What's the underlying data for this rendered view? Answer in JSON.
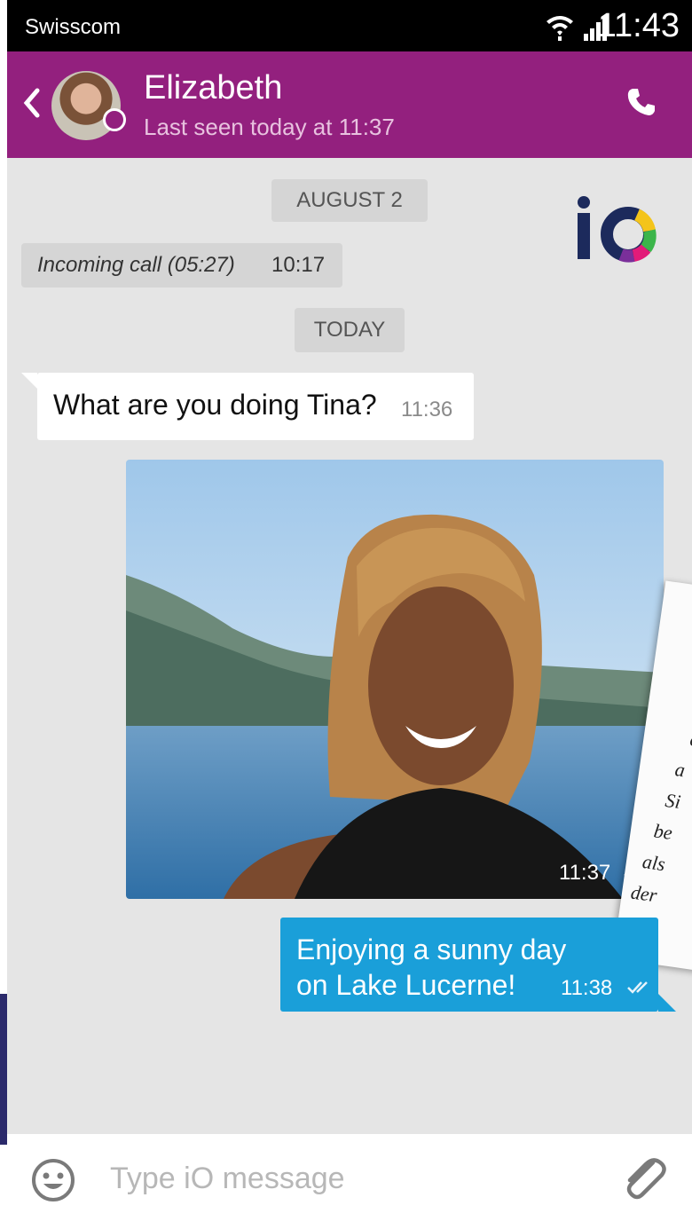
{
  "status_bar": {
    "carrier": "Swisscom",
    "time": "11:43"
  },
  "header": {
    "back_icon": "chevron-left-icon",
    "contact_name": "Elizabeth",
    "last_seen": "Last seen today at 11:37",
    "call_icon": "phone-icon",
    "color": "#93207e"
  },
  "chat": {
    "date_chips": [
      "AUGUST 2",
      "TODAY"
    ],
    "call_log": {
      "label": "Incoming call (05:27)",
      "time": "10:17"
    },
    "messages": [
      {
        "direction": "incoming",
        "text": "What are you doing Tina?",
        "time": "11:36"
      },
      {
        "direction": "outgoing",
        "type": "image",
        "time": "11:37",
        "status": "read"
      },
      {
        "direction": "outgoing",
        "lines": [
          "Enjoying a sunny day",
          "on Lake Lucerne!"
        ],
        "time": "11:38",
        "status": "read"
      }
    ]
  },
  "note_fragments": [
    "e",
    "a",
    "Si",
    "be",
    "als",
    "der"
  ],
  "composer": {
    "placeholder": "Type iO message",
    "emoji_icon": "emoji-icon",
    "attach_icon": "paperclip-icon"
  },
  "colors": {
    "outgoing_bubble": "#1a9fd9",
    "chat_bg": "#e5e5e5"
  }
}
